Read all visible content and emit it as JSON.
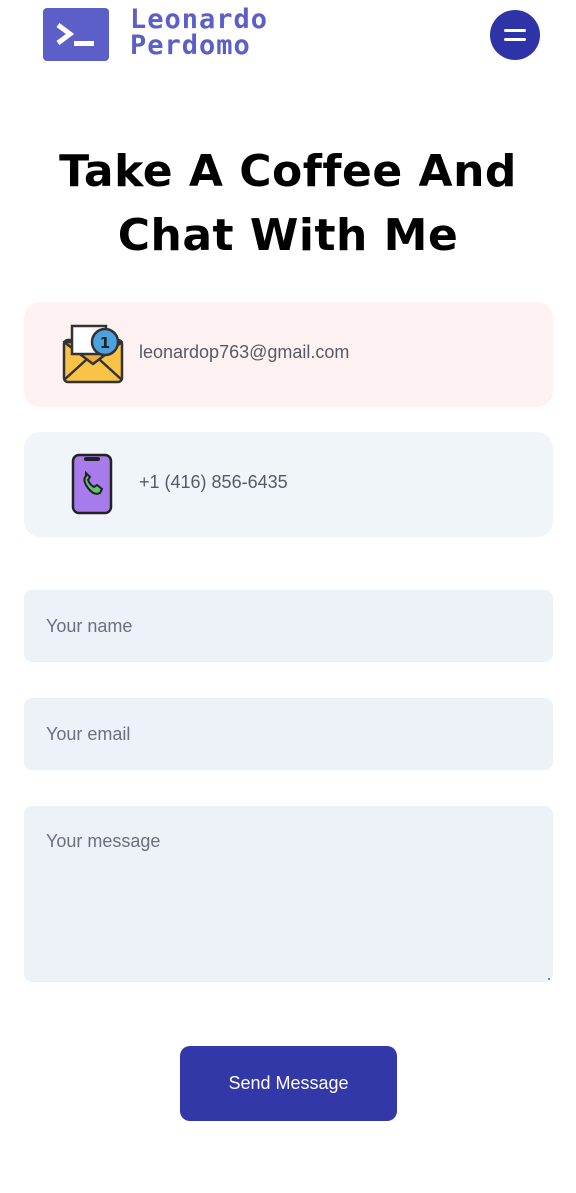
{
  "header": {
    "logo_line1": "Leonardo",
    "logo_line2": "Perdomo",
    "logo_icon": "terminal-icon",
    "menu_icon": "hamburger-menu-icon"
  },
  "hero": {
    "title_line1": "Take A Coffee And",
    "title_line2": "Chat With Me"
  },
  "contact": {
    "email": "leonardop763@gmail.com",
    "email_icon": "envelope-icon",
    "email_badge": "1",
    "phone": "+1 (416) 856-6435",
    "phone_icon": "smartphone-icon"
  },
  "form": {
    "name_placeholder": "Your name",
    "email_placeholder": "Your email",
    "message_placeholder": "Your message",
    "send_label": "Send Message"
  },
  "colors": {
    "brand": "#5b5fc7",
    "button": "#3238a8",
    "email_card_bg": "#fdf1f2",
    "phone_card_bg": "#f0f5fa",
    "field_bg": "#edf1f8"
  }
}
